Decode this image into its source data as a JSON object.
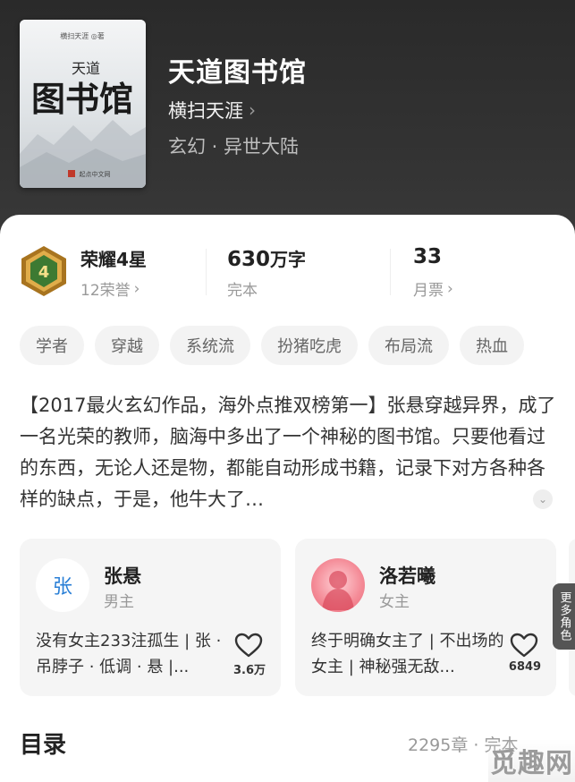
{
  "book": {
    "title": "天道图书馆",
    "author": "横扫天涯",
    "genre": "玄幻 · 异世大陆",
    "cover": {
      "author": "横扫天涯 ◎著",
      "small_title": "天道",
      "big_title": "图书馆",
      "publisher": "起点中文网"
    }
  },
  "stats": {
    "honor": {
      "label": "荣耀4星",
      "badge_number": "4",
      "sub": "12荣誉"
    },
    "words": {
      "value": "630",
      "unit": "万字",
      "sub": "完本"
    },
    "tickets": {
      "value": "33",
      "sub": "月票"
    }
  },
  "tags": [
    "学者",
    "穿越",
    "系统流",
    "扮猪吃虎",
    "布局流",
    "热血"
  ],
  "description": "【2017最火玄幻作品，海外点推双榜第一】张悬穿越异界，成了一名光荣的教师，脑海中多出了一个神秘的图书馆。只要他看过的东西，无论人还是物，都能自动形成书籍，记录下对方各种各样的缺点，于是，他牛大了…",
  "characters": [
    {
      "avatar_text": "张",
      "name": "张悬",
      "role": "男主",
      "text": "没有女主233注孤生 | 张 · 吊脖子 · 低调 · 悬 |...",
      "likes": "3.6万"
    },
    {
      "avatar_text": "",
      "name": "洛若曦",
      "role": "女主",
      "text": "终于明确女主了 | 不出场的女主 | 神秘强无敌...",
      "likes": "6849"
    }
  ],
  "more_roles": "更多角色",
  "toc": {
    "title": "目录",
    "meta": "2295章 · 完本"
  },
  "watermark": "觅趣网",
  "colors": {
    "hero_bg": "#2f2f2f",
    "card_bg": "#f5f5f5",
    "tag_bg": "#f3f3f3",
    "avatar_text": "#2a7fd6"
  }
}
